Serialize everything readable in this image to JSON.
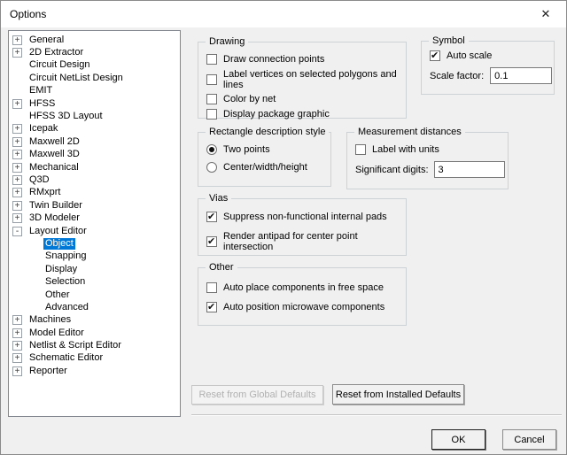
{
  "window": {
    "title": "Options",
    "close_icon": "✕"
  },
  "tree": {
    "items": [
      {
        "label": "General",
        "expander": "+",
        "level": 0,
        "selected": false
      },
      {
        "label": "2D Extractor",
        "expander": "+",
        "level": 0,
        "selected": false
      },
      {
        "label": "Circuit Design",
        "expander": "",
        "level": 0,
        "selected": false
      },
      {
        "label": "Circuit NetList Design",
        "expander": "",
        "level": 0,
        "selected": false
      },
      {
        "label": "EMIT",
        "expander": "",
        "level": 0,
        "selected": false
      },
      {
        "label": "HFSS",
        "expander": "+",
        "level": 0,
        "selected": false
      },
      {
        "label": "HFSS 3D Layout",
        "expander": "",
        "level": 0,
        "selected": false
      },
      {
        "label": "Icepak",
        "expander": "+",
        "level": 0,
        "selected": false
      },
      {
        "label": "Maxwell 2D",
        "expander": "+",
        "level": 0,
        "selected": false
      },
      {
        "label": "Maxwell 3D",
        "expander": "+",
        "level": 0,
        "selected": false
      },
      {
        "label": "Mechanical",
        "expander": "+",
        "level": 0,
        "selected": false
      },
      {
        "label": "Q3D",
        "expander": "+",
        "level": 0,
        "selected": false
      },
      {
        "label": "RMxprt",
        "expander": "+",
        "level": 0,
        "selected": false
      },
      {
        "label": "Twin Builder",
        "expander": "+",
        "level": 0,
        "selected": false
      },
      {
        "label": "3D Modeler",
        "expander": "+",
        "level": 0,
        "selected": false
      },
      {
        "label": "Layout Editor",
        "expander": "-",
        "level": 0,
        "selected": false
      },
      {
        "label": "Object",
        "expander": "",
        "level": 1,
        "selected": true
      },
      {
        "label": "Snapping",
        "expander": "",
        "level": 1,
        "selected": false
      },
      {
        "label": "Display",
        "expander": "",
        "level": 1,
        "selected": false
      },
      {
        "label": "Selection",
        "expander": "",
        "level": 1,
        "selected": false
      },
      {
        "label": "Other",
        "expander": "",
        "level": 1,
        "selected": false
      },
      {
        "label": "Advanced",
        "expander": "",
        "level": 1,
        "selected": false
      },
      {
        "label": "Machines",
        "expander": "+",
        "level": 0,
        "selected": false
      },
      {
        "label": "Model Editor",
        "expander": "+",
        "level": 0,
        "selected": false
      },
      {
        "label": "Netlist & Script Editor",
        "expander": "+",
        "level": 0,
        "selected": false
      },
      {
        "label": "Schematic Editor",
        "expander": "+",
        "level": 0,
        "selected": false
      },
      {
        "label": "Reporter",
        "expander": "+",
        "level": 0,
        "selected": false
      }
    ]
  },
  "groups": {
    "drawing": {
      "title": "Drawing",
      "checkboxes": [
        {
          "label": "Draw connection points",
          "checked": false
        },
        {
          "label": "Label vertices on selected polygons and lines",
          "checked": false
        },
        {
          "label": "Color by net",
          "checked": false
        },
        {
          "label": "Display package graphic",
          "checked": false
        }
      ]
    },
    "symbol": {
      "title": "Symbol",
      "auto_scale": {
        "label": "Auto scale",
        "checked": true
      },
      "scale_factor": {
        "label": "Scale factor:",
        "value": "0.1"
      }
    },
    "rectangle_style": {
      "title": "Rectangle description style",
      "radios": [
        {
          "label": "Two points",
          "selected": true
        },
        {
          "label": "Center/width/height",
          "selected": false
        }
      ]
    },
    "measurement": {
      "title": "Measurement distances",
      "checkboxes": [
        {
          "label": "Label with units",
          "checked": false
        }
      ],
      "significant_digits": {
        "label": "Significant digits:",
        "value": "3"
      }
    },
    "vias": {
      "title": "Vias",
      "checkboxes": [
        {
          "label": "Suppress non-functional internal pads",
          "checked": true
        },
        {
          "label": "Render antipad for center point intersection",
          "checked": true
        }
      ]
    },
    "other": {
      "title": "Other",
      "checkboxes": [
        {
          "label": "Auto place components in free space",
          "checked": false
        },
        {
          "label": "Auto position microwave components",
          "checked": true
        }
      ]
    }
  },
  "buttons": {
    "reset_global": {
      "label": "Reset from Global Defaults",
      "enabled": false
    },
    "reset_installed": {
      "label": "Reset from Installed Defaults",
      "enabled": true
    },
    "ok": "OK",
    "cancel": "Cancel"
  },
  "colors": {
    "selection": "#0078d7",
    "selection_text": "#ffffff",
    "titlebar": "#ffffff",
    "client_background": "#f0f0f0"
  }
}
